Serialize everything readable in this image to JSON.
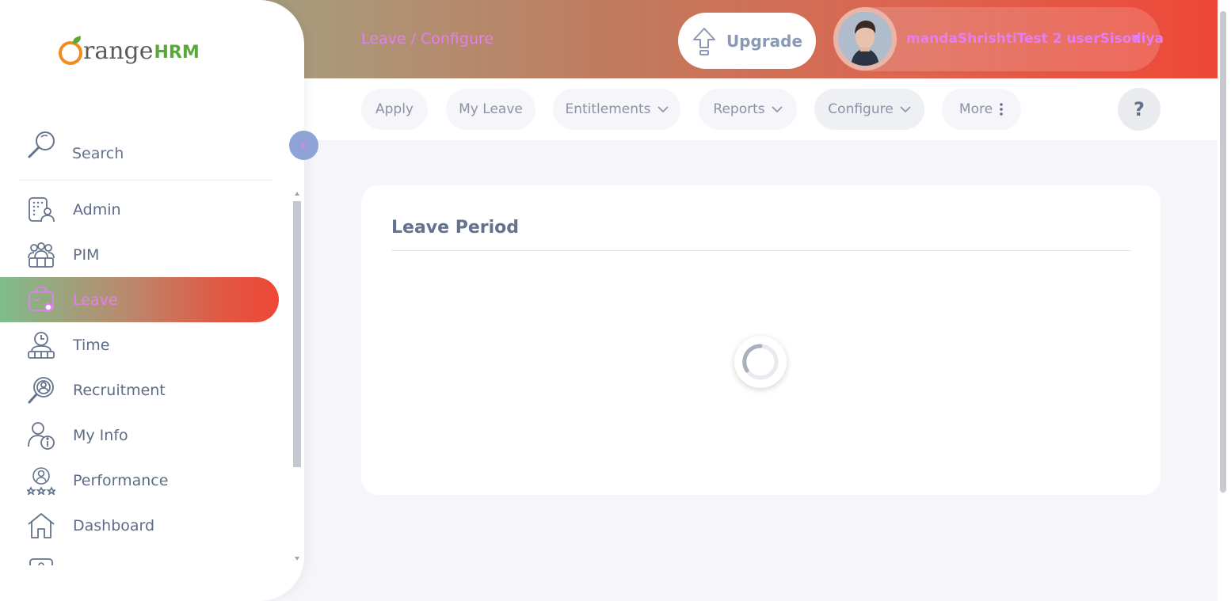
{
  "app": {
    "logo_text": "range",
    "logo_suffix": "HRM"
  },
  "header": {
    "breadcrumb": "Leave / Configure",
    "upgrade_label": "Upgrade",
    "user_name": "mandaShrishtiTest 2 userSisodiya",
    "colors": {
      "accent_text": "#e37ff2",
      "gradient_start": "#8f9f74",
      "gradient_end": "#ee4737"
    }
  },
  "subnav": {
    "items": [
      {
        "label": "Apply",
        "icon": ""
      },
      {
        "label": "My Leave",
        "icon": ""
      },
      {
        "label": "Entitlements",
        "icon": "chevron-down-icon"
      },
      {
        "label": "Reports",
        "icon": "chevron-down-icon"
      },
      {
        "label": "Configure",
        "icon": "chevron-down-icon",
        "active": true
      },
      {
        "label": "More",
        "icon": "more-vertical-icon"
      }
    ],
    "help_label": "?"
  },
  "sidebar": {
    "search_placeholder": "Search",
    "items": [
      {
        "label": "Admin",
        "icon": "admin-icon"
      },
      {
        "label": "PIM",
        "icon": "pim-icon"
      },
      {
        "label": "Leave",
        "icon": "leave-icon",
        "active": true
      },
      {
        "label": "Time",
        "icon": "time-icon"
      },
      {
        "label": "Recruitment",
        "icon": "recruitment-icon"
      },
      {
        "label": "My Info",
        "icon": "my-info-icon"
      },
      {
        "label": "Performance",
        "icon": "performance-icon"
      },
      {
        "label": "Dashboard",
        "icon": "dashboard-icon"
      }
    ]
  },
  "main": {
    "card_title": "Leave Period",
    "loading": true
  }
}
